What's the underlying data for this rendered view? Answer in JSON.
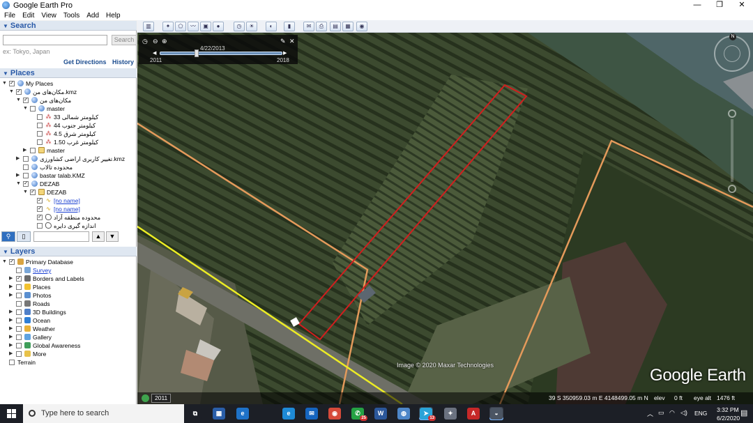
{
  "window": {
    "title": "Google Earth Pro",
    "controls": [
      "—",
      "❐",
      "✕"
    ]
  },
  "menu": [
    "File",
    "Edit",
    "View",
    "Tools",
    "Add",
    "Help"
  ],
  "search": {
    "header": "Search",
    "button": "Search",
    "placeholder": "",
    "hint": "ex: Tokyo, Japan",
    "links": [
      "Get Directions",
      "History"
    ]
  },
  "places": {
    "header": "Places",
    "items": [
      {
        "label": "My Places",
        "depth": 0,
        "expanded": true,
        "checked": true,
        "icon": "globe"
      },
      {
        "label": "مکان‌های من.kmz",
        "depth": 1,
        "expanded": true,
        "checked": true,
        "icon": "globe"
      },
      {
        "label": "مکان‌های من",
        "depth": 2,
        "expanded": true,
        "checked": true,
        "icon": "globe"
      },
      {
        "label": "master",
        "depth": 3,
        "expanded": true,
        "checked": false,
        "icon": "globe"
      },
      {
        "label": "کیلومتر شمالی 33",
        "depth": 4,
        "checked": false,
        "icon": "pin"
      },
      {
        "label": "کیلومتر جنوب 44",
        "depth": 4,
        "checked": false,
        "icon": "pin"
      },
      {
        "label": "کیلومتر شرق 4.5",
        "depth": 4,
        "checked": false,
        "icon": "pin"
      },
      {
        "label": "کیلومتر غرب 1.50",
        "depth": 4,
        "checked": false,
        "icon": "pin"
      },
      {
        "label": "master",
        "depth": 3,
        "expanded": false,
        "checked": false,
        "icon": "folder"
      },
      {
        "label": "تغییر کاربری اراضی کشاورزی.kmz",
        "depth": 2,
        "expanded": false,
        "checked": false,
        "icon": "globe"
      },
      {
        "label": "محدوده تالاب",
        "depth": 2,
        "checked": false,
        "icon": "globe"
      },
      {
        "label": "bastar talab.KMZ",
        "depth": 2,
        "expanded": false,
        "checked": false,
        "icon": "globe"
      },
      {
        "label": "DEZAB",
        "depth": 2,
        "expanded": true,
        "checked": true,
        "icon": "globe"
      },
      {
        "label": "DEZAB",
        "depth": 3,
        "expanded": true,
        "checked": true,
        "icon": "folder"
      },
      {
        "label": "[no name]",
        "depth": 4,
        "checked": true,
        "icon": "path",
        "link": true
      },
      {
        "label": "[no name]",
        "depth": 4,
        "checked": true,
        "icon": "path",
        "link": true
      },
      {
        "label": "محدوده منطقه آزاد",
        "depth": 4,
        "checked": true,
        "icon": "poly"
      },
      {
        "label": "اندازه گیری دایره",
        "depth": 4,
        "checked": false,
        "icon": "poly"
      }
    ]
  },
  "layers": {
    "header": "Layers",
    "items": [
      {
        "label": "Primary Database",
        "depth": 0,
        "expanded": true,
        "checked": true,
        "color": "#d9a441"
      },
      {
        "label": "Survey",
        "depth": 1,
        "checked": false,
        "color": "#7aa7d8",
        "link": true
      },
      {
        "label": "Borders and Labels",
        "depth": 1,
        "expanded": false,
        "checked": true,
        "color": "#6b6b6b"
      },
      {
        "label": "Places",
        "depth": 1,
        "expanded": false,
        "checked": false,
        "color": "#f2c230"
      },
      {
        "label": "Photos",
        "depth": 1,
        "expanded": false,
        "checked": false,
        "color": "#5a8fd0"
      },
      {
        "label": "Roads",
        "depth": 1,
        "checked": false,
        "color": "#777777"
      },
      {
        "label": "3D Buildings",
        "depth": 1,
        "expanded": false,
        "checked": false,
        "color": "#4f7fc8"
      },
      {
        "label": "Ocean",
        "depth": 1,
        "expanded": false,
        "checked": false,
        "color": "#2f7fd6"
      },
      {
        "label": "Weather",
        "depth": 1,
        "expanded": false,
        "checked": false,
        "color": "#e9b23a"
      },
      {
        "label": "Gallery",
        "depth": 1,
        "expanded": false,
        "checked": false,
        "color": "#5fa3e0"
      },
      {
        "label": "Global Awareness",
        "depth": 1,
        "expanded": false,
        "checked": false,
        "color": "#3f9e5a"
      },
      {
        "label": "More",
        "depth": 1,
        "expanded": false,
        "checked": false,
        "color": "#e8c24a"
      },
      {
        "label": "Terrain",
        "depth": 0,
        "checked": false,
        "color": ""
      }
    ]
  },
  "toolbar": {
    "icons": [
      "sidebar-icon",
      "placemark-icon",
      "polygon-icon",
      "path-icon",
      "image-overlay-icon",
      "record-tour-icon",
      "historical-imagery-icon",
      "sunlight-icon",
      "planets-icon",
      "ruler-icon",
      "email-icon",
      "print-icon",
      "save-image-icon",
      "maps-icon",
      "earth-icon"
    ],
    "glyphs": [
      "▥",
      "✦",
      "⬠",
      "〰",
      "▣",
      "●",
      "◷",
      "☀",
      "◐",
      "▮",
      "✉",
      "⎙",
      "▤",
      "▦",
      "◉"
    ]
  },
  "timeslider": {
    "date": "4/22/2013",
    "start": "2011",
    "end": "2018",
    "position": 0.3
  },
  "map": {
    "attribution": "Image © 2020 Maxar Technologies",
    "logo": "Google Earth",
    "year_badge": "2011",
    "coords": "39 S 350959.03 m E 4148499.05 m N",
    "elev_label": "elev",
    "elev": "0 ft",
    "eye_alt_label": "eye alt",
    "eye_alt": "1476 ft",
    "compass_n": "N"
  },
  "taskbar": {
    "search_placeholder": "Type here to search",
    "apps": [
      {
        "name": "task-view",
        "glyph": "⧉",
        "color": "#1c1f26"
      },
      {
        "name": "store",
        "glyph": "▦",
        "color": "#2a5ea8"
      },
      {
        "name": "edge-legacy",
        "glyph": "e",
        "color": "#1e72c8"
      },
      {
        "name": "edge",
        "glyph": "e",
        "color": "#1e8ad6"
      },
      {
        "name": "mail",
        "glyph": "✉",
        "color": "#1565c0"
      },
      {
        "name": "chrome",
        "glyph": "◉",
        "color": "#d64a3a"
      },
      {
        "name": "whatsapp",
        "glyph": "✆",
        "color": "#25a244",
        "badge": "25"
      },
      {
        "name": "word",
        "glyph": "W",
        "color": "#2b579a"
      },
      {
        "name": "google-earth-globe",
        "glyph": "◍",
        "color": "#4d86c8"
      },
      {
        "name": "telegram",
        "glyph": "➤",
        "color": "#2aa3d8",
        "badge": "13",
        "active": true
      },
      {
        "name": "satellite",
        "glyph": "✦",
        "color": "#6b7280"
      },
      {
        "name": "acrobat",
        "glyph": "A",
        "color": "#c62828"
      },
      {
        "name": "google-earth-pro",
        "glyph": "◒",
        "color": "#4b5563",
        "active": true
      }
    ],
    "tray": {
      "lang": "ENG",
      "time": "3:32 PM",
      "date": "6/2/2020"
    }
  }
}
